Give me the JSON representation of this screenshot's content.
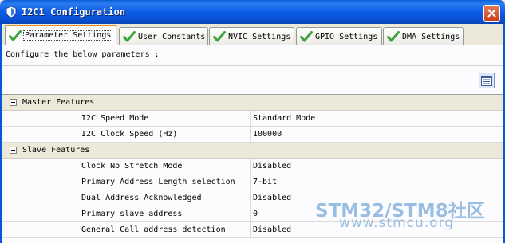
{
  "window": {
    "title": "I2C1 Configuration",
    "title_bar_color": "#0b56d6"
  },
  "tabs": [
    {
      "label": "Parameter Settings",
      "icon": "check-icon",
      "active": true
    },
    {
      "label": "User Constants",
      "icon": "check-icon",
      "active": false
    },
    {
      "label": "NVIC Settings",
      "icon": "check-icon",
      "active": false
    },
    {
      "label": "GPIO Settings",
      "icon": "check-icon",
      "active": false
    },
    {
      "label": "DMA Settings",
      "icon": "check-icon",
      "active": false
    }
  ],
  "panel": {
    "instruction": "Configure the below parameters :",
    "toolbar_icon": "list-view-icon"
  },
  "categories": [
    {
      "label": "Master Features",
      "expanded": true,
      "params": [
        {
          "name": "I2C Speed Mode",
          "value": "Standard Mode"
        },
        {
          "name": "I2C Clock Speed (Hz)",
          "value": "100000"
        }
      ]
    },
    {
      "label": "Slave Features",
      "expanded": true,
      "params": [
        {
          "name": "Clock No Stretch Mode",
          "value": "Disabled"
        },
        {
          "name": "Primary Address Length selection",
          "value": "7-bit"
        },
        {
          "name": "Dual Address Acknowledged",
          "value": "Disabled"
        },
        {
          "name": "Primary slave address",
          "value": "0"
        },
        {
          "name": "General Call address detection",
          "value": "Disabled"
        }
      ]
    }
  ],
  "watermark": {
    "line1": "STM32/STM8社区",
    "line2": "www.stmcu.org"
  },
  "colors": {
    "check_green": "#3aa33a",
    "active_tab_accent": "#e68b2c",
    "close_button": "#c8401a"
  }
}
